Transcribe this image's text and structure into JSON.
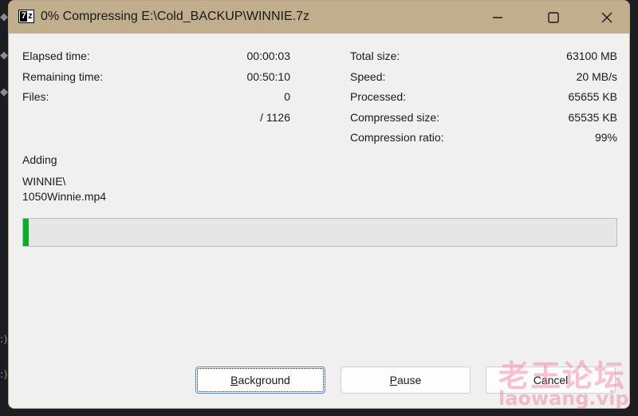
{
  "window": {
    "title": "0% Compressing E:\\Cold_BACKUP\\WINNIE.7z",
    "app_icon": "7z-icon",
    "controls": {
      "minimize": "minimize-icon",
      "maximize": "maximize-icon",
      "close": "close-icon"
    }
  },
  "stats_left": [
    {
      "label": "Elapsed time:",
      "value": "00:00:03"
    },
    {
      "label": "Remaining time:",
      "value": "00:50:10"
    },
    {
      "label": "Files:",
      "value": "0"
    },
    {
      "label": "",
      "value": "/ 1126"
    }
  ],
  "stats_right": [
    {
      "label": "Total size:",
      "value": "63100 MB"
    },
    {
      "label": "Speed:",
      "value": "20 MB/s"
    },
    {
      "label": "Processed:",
      "value": "65655 KB"
    },
    {
      "label": "Compressed size:",
      "value": "65535 KB"
    },
    {
      "label": "Compression ratio:",
      "value": "99%"
    }
  ],
  "status": {
    "action": "Adding",
    "path_line1": "WINNIE\\",
    "path_line2": "1050Winnie.mp4"
  },
  "progress": {
    "percent": 0.1
  },
  "buttons": {
    "background": {
      "accel": "B",
      "rest": "ackground"
    },
    "pause": {
      "accel": "P",
      "rest": "ause"
    },
    "cancel": {
      "label": "Cancel"
    }
  },
  "watermark": {
    "cn": "老王论坛",
    "url": "laowang.vip"
  },
  "colors": {
    "titlebar": "#c0ae8c",
    "progress_fill": "#06b025"
  }
}
